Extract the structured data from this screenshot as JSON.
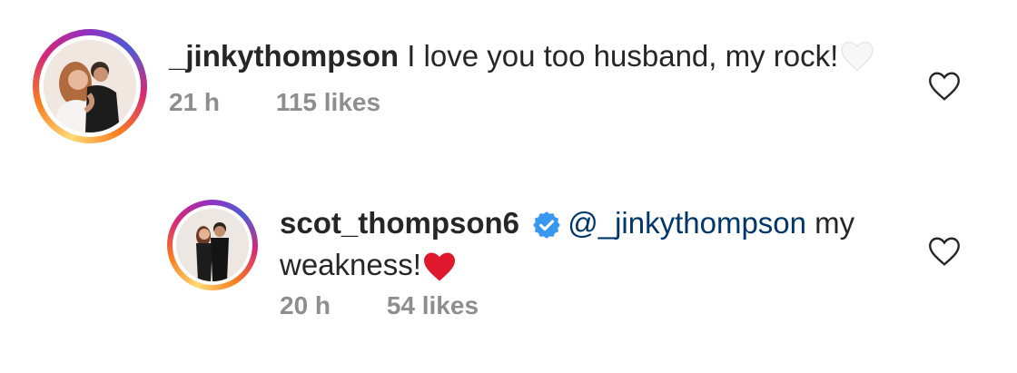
{
  "comments": [
    {
      "username": "_jinkythompson",
      "text": " I love you too husband, my rock!",
      "emoji": "white-heart",
      "time": "21 h",
      "likes": "115 likes",
      "verified": false
    },
    {
      "username": "scot_thompson6",
      "mention": "@_jinkythompson",
      "text_line1": " my",
      "text_line2": "weakness!",
      "emoji": "red-heart",
      "time": "20 h",
      "likes": "54 likes",
      "verified": true
    }
  ],
  "colors": {
    "text": "#262626",
    "meta": "#8e8e8e",
    "mention": "#00376b",
    "verified_badge": "#3897f0",
    "red_heart": "#e0182d"
  },
  "icons": [
    "heart-outline-icon",
    "verified-badge-icon",
    "white-heart-emoji",
    "red-heart-emoji"
  ]
}
